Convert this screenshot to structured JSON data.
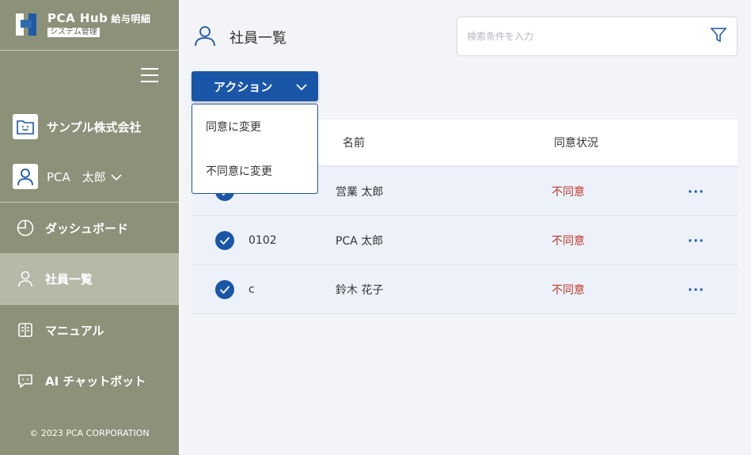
{
  "brand": {
    "title": "PCA Hub",
    "subtitle": "給与明細",
    "badge": "システム管理"
  },
  "sidebar": {
    "company": "サンプル株式会社",
    "user": "PCA　太郎",
    "nav": [
      {
        "label": "ダッシュボード",
        "icon": "pie-chart-icon"
      },
      {
        "label": "社員一覧",
        "icon": "person-icon",
        "active": true
      },
      {
        "label": "マニュアル",
        "icon": "book-icon"
      },
      {
        "label": "AI チャットボット",
        "icon": "chat-icon"
      }
    ],
    "copyright": "© 2023 PCA CORPORATION"
  },
  "header": {
    "title": "社員一覧"
  },
  "search": {
    "placeholder": "検索条件を入力"
  },
  "action": {
    "label": "アクション",
    "menu": [
      "同意に変更",
      "不同意に変更"
    ]
  },
  "table": {
    "columns": [
      "名前",
      "同意状況"
    ],
    "rows": [
      {
        "code": "",
        "name": "営業 太郎",
        "status": "不同意",
        "checked": true
      },
      {
        "code": "0102",
        "name": "PCA 太郎",
        "status": "不同意",
        "checked": true
      },
      {
        "code": "c",
        "name": "鈴木 花子",
        "status": "不同意",
        "checked": true
      }
    ],
    "more": "···"
  },
  "colors": {
    "sidebar": "#8c9179",
    "sidebar_active": "#b5b9a8",
    "primary": "#1a56a8",
    "status_negative": "#c0392b"
  }
}
